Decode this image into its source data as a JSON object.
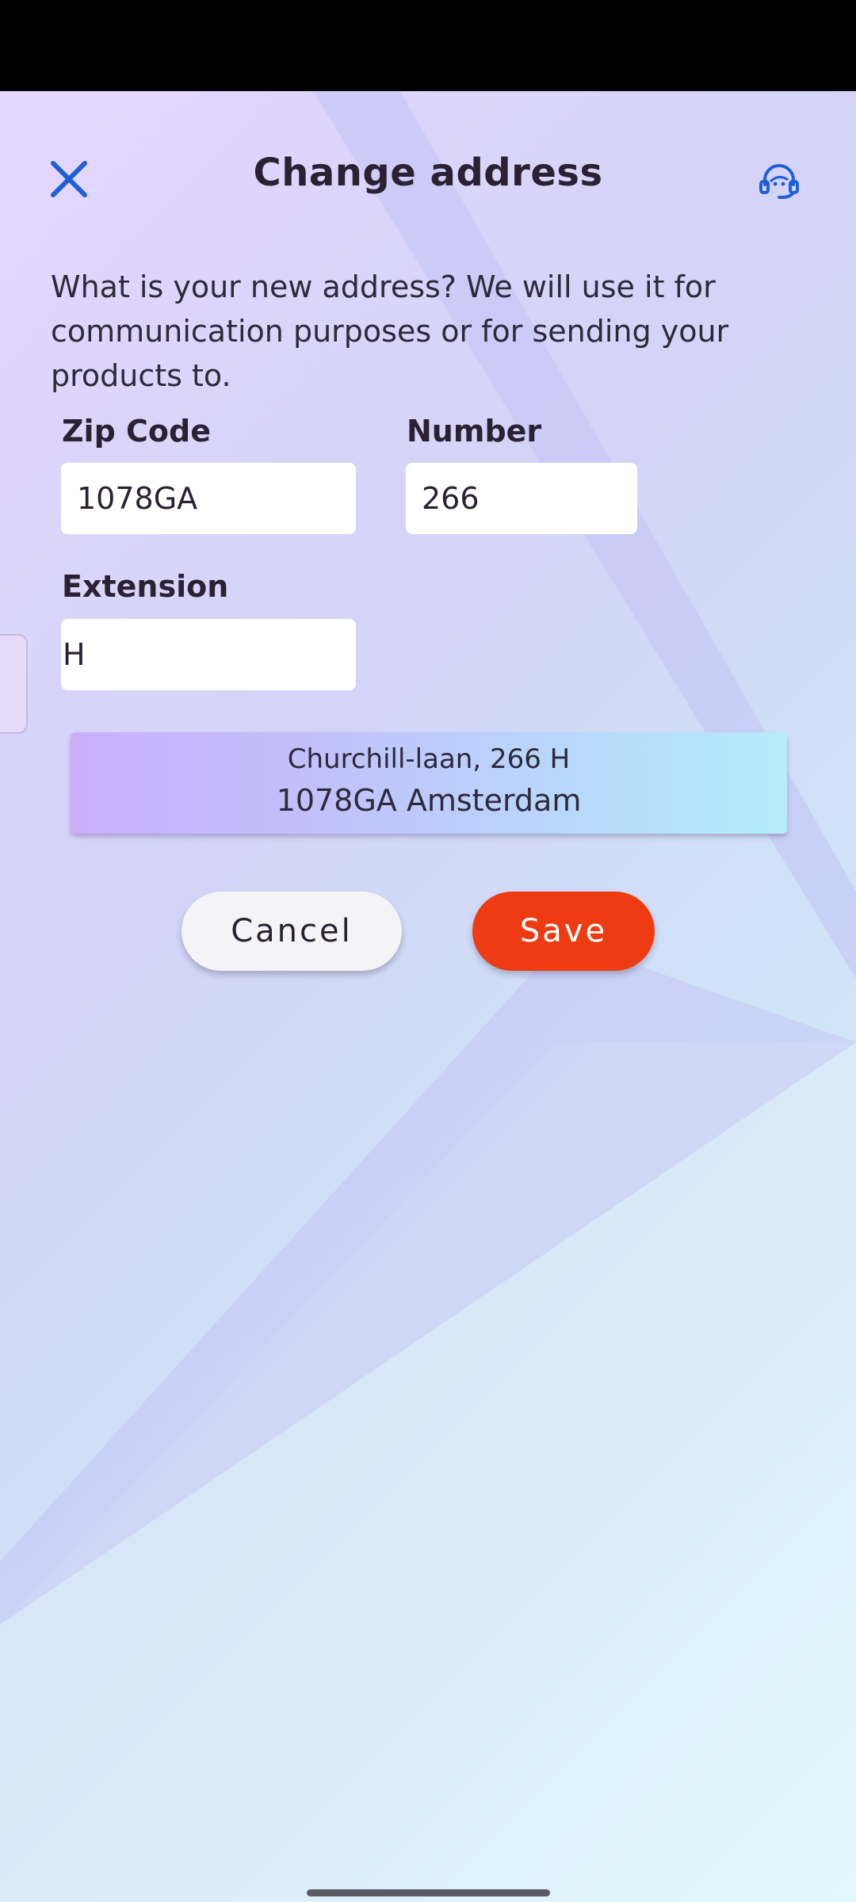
{
  "header": {
    "title": "Change address",
    "close_icon": "close-icon",
    "support_icon": "headset-support-icon"
  },
  "intro_text": "What is your new address? We will use it for communication purposes or for sending your products to.",
  "form": {
    "zip_label": "Zip Code",
    "zip_value": "1078GA",
    "number_label": "Number",
    "number_value": "266",
    "extension_label": "Extension",
    "extension_value": "H"
  },
  "address_preview": {
    "line1": "Churchill-laan, 266 H",
    "line2": "1078GA Amsterdam"
  },
  "actions": {
    "cancel_label": "Cancel",
    "save_label": "Save"
  },
  "colors": {
    "accent_blue": "#1f5fd6",
    "save_red": "#ee3b12",
    "title_text": "#2a2233"
  }
}
